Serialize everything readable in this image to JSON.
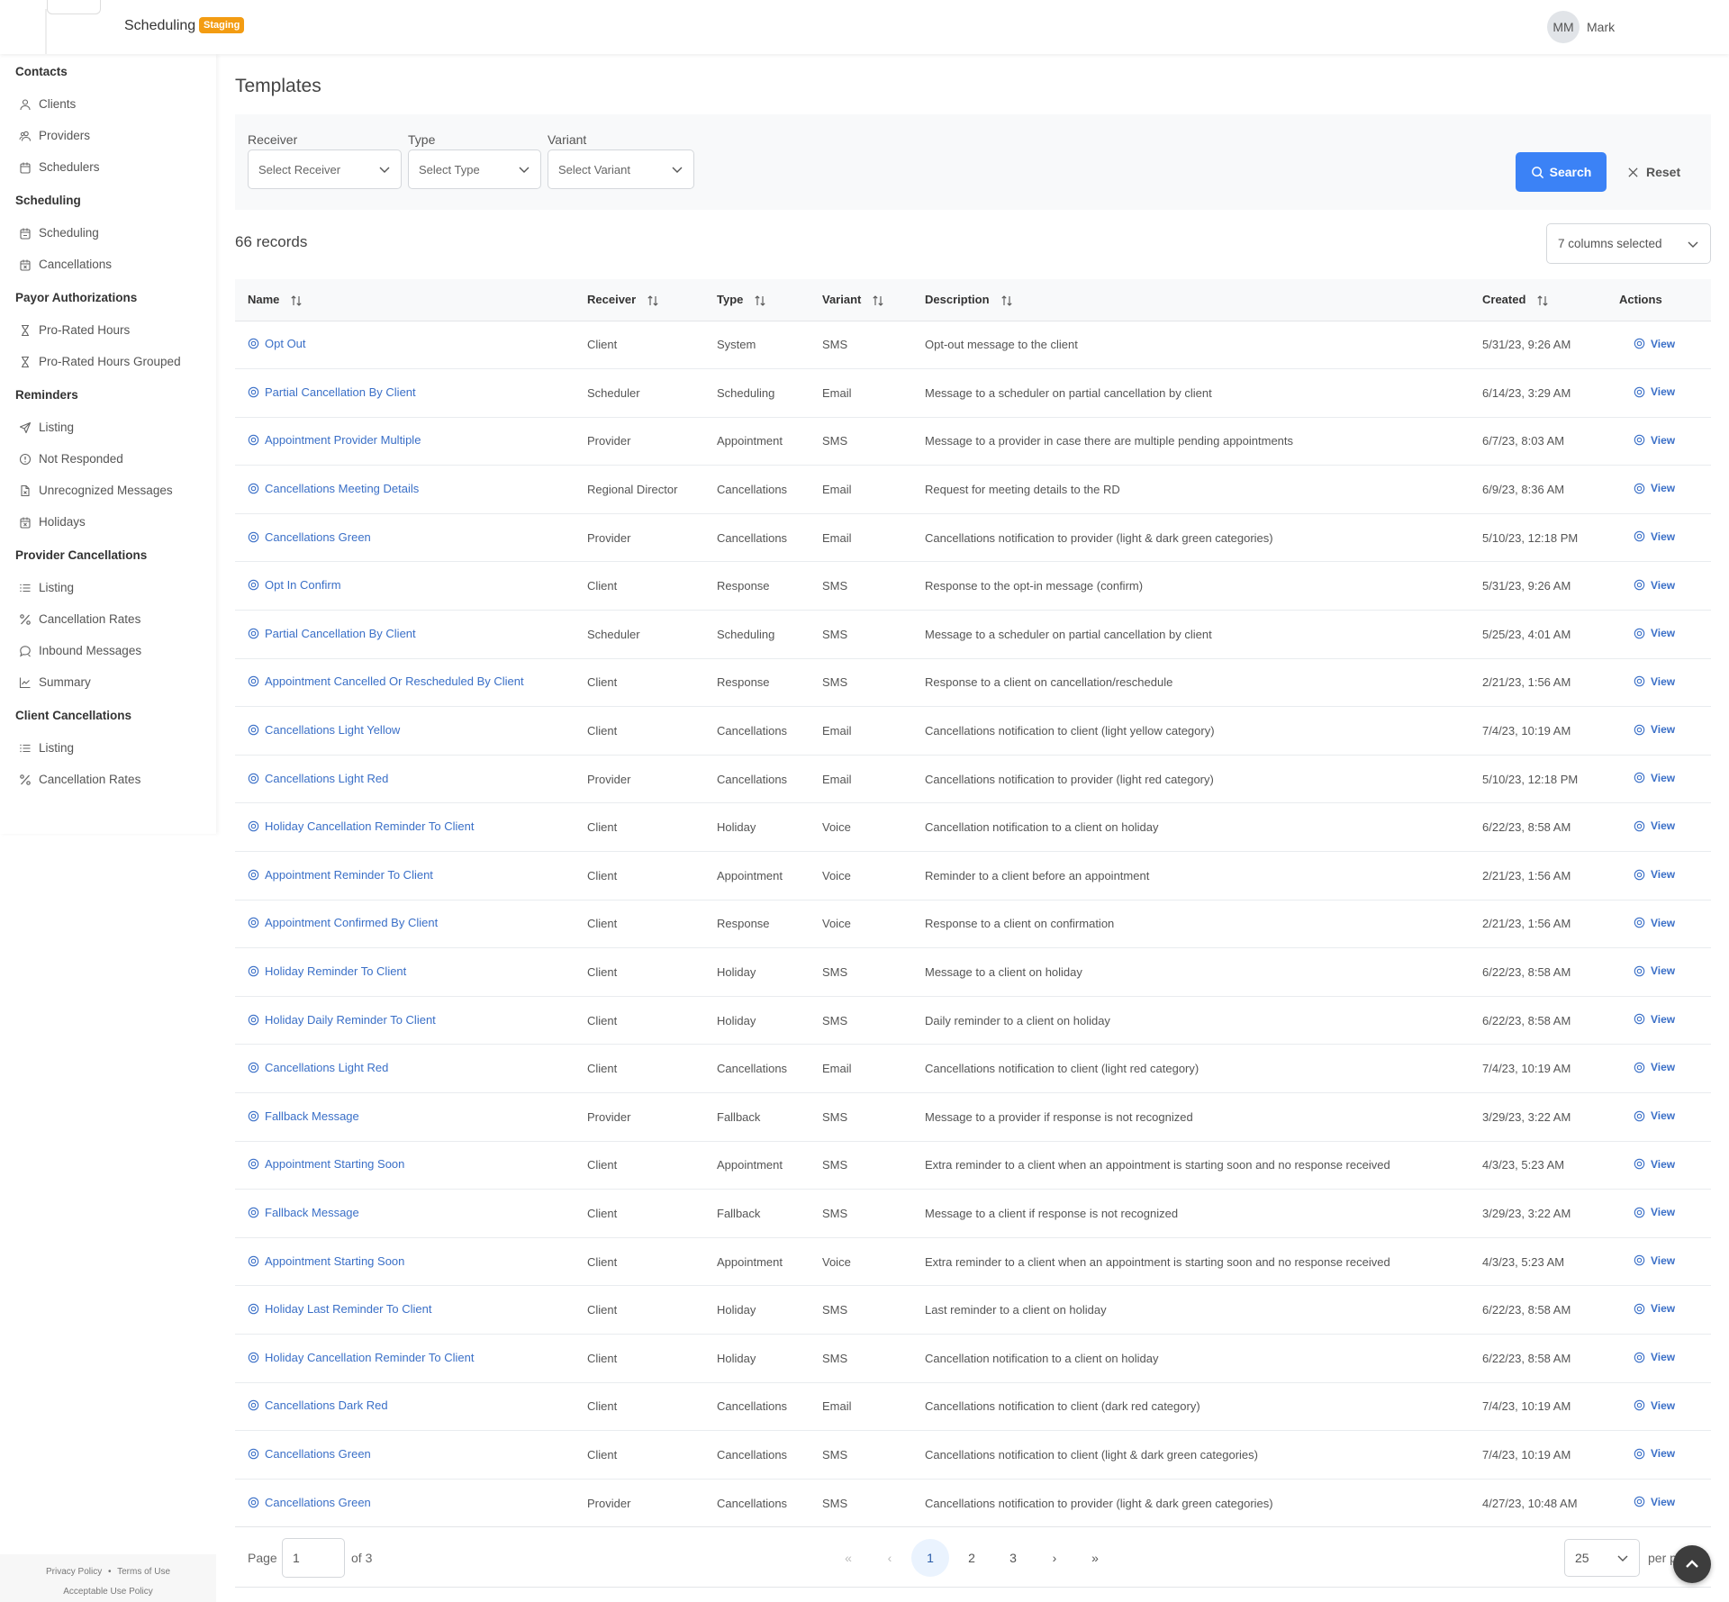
{
  "header": {
    "app_title": "Scheduling",
    "env_badge": "Staging",
    "user_initials": "MM",
    "user_name": "Mark"
  },
  "sidebar": {
    "sections": [
      {
        "title": "Contacts",
        "items": [
          {
            "label": "Clients",
            "icon": "user-icon"
          },
          {
            "label": "Providers",
            "icon": "users-icon"
          },
          {
            "label": "Schedulers",
            "icon": "calendar-icon"
          }
        ]
      },
      {
        "title": "Scheduling",
        "items": [
          {
            "label": "Scheduling",
            "icon": "calendar-minus-icon"
          },
          {
            "label": "Cancellations",
            "icon": "calendar-x-icon"
          }
        ]
      },
      {
        "title": "Payor Authorizations",
        "items": [
          {
            "label": "Pro-Rated Hours",
            "icon": "hourglass-icon"
          },
          {
            "label": "Pro-Rated Hours Grouped",
            "icon": "hourglass-icon"
          }
        ]
      },
      {
        "title": "Reminders",
        "items": [
          {
            "label": "Listing",
            "icon": "send-icon"
          },
          {
            "label": "Not Responded",
            "icon": "alert-circle-icon"
          },
          {
            "label": "Unrecognized Messages",
            "icon": "file-x-icon"
          },
          {
            "label": "Holidays",
            "icon": "calendar-x-icon"
          }
        ]
      },
      {
        "title": "Provider Cancellations",
        "items": [
          {
            "label": "Listing",
            "icon": "list-icon"
          },
          {
            "label": "Cancellation Rates",
            "icon": "percent-icon"
          },
          {
            "label": "Inbound Messages",
            "icon": "message-icon"
          },
          {
            "label": "Summary",
            "icon": "chart-line-icon"
          }
        ]
      },
      {
        "title": "Client Cancellations",
        "items": [
          {
            "label": "Listing",
            "icon": "list-icon"
          },
          {
            "label": "Cancellation Rates",
            "icon": "percent-icon"
          }
        ]
      }
    ],
    "footer": {
      "privacy": "Privacy Policy",
      "separator": "•",
      "terms": "Terms of Use",
      "aup": "Acceptable Use Policy"
    }
  },
  "main": {
    "title": "Templates",
    "filters": {
      "receiver_label": "Receiver",
      "receiver_placeholder": "Select Receiver",
      "type_label": "Type",
      "type_placeholder": "Select Type",
      "variant_label": "Variant",
      "variant_placeholder": "Select Variant",
      "search_label": "Search",
      "reset_label": "Reset"
    },
    "records_count": "66",
    "records_label": "records",
    "columns_selected": "7 columns selected",
    "table": {
      "columns": [
        "Name",
        "Receiver",
        "Type",
        "Variant",
        "Description",
        "Created",
        "Actions"
      ],
      "view_label": "View",
      "rows": [
        {
          "name": "Opt Out",
          "receiver": "Client",
          "type": "System",
          "variant": "SMS",
          "description": "Opt-out message to the client",
          "created": "5/31/23, 9:26 AM"
        },
        {
          "name": "Partial Cancellation By Client",
          "receiver": "Scheduler",
          "type": "Scheduling",
          "variant": "Email",
          "description": "Message to a scheduler on partial cancellation by client",
          "created": "6/14/23, 3:29 AM"
        },
        {
          "name": "Appointment Provider Multiple",
          "receiver": "Provider",
          "type": "Appointment",
          "variant": "SMS",
          "description": "Message to a provider in case there are multiple pending appointments",
          "created": "6/7/23, 8:03 AM"
        },
        {
          "name": "Cancellations Meeting Details",
          "receiver": "Regional Director",
          "type": "Cancellations",
          "variant": "Email",
          "description": "Request for meeting details to the RD",
          "created": "6/9/23, 8:36 AM"
        },
        {
          "name": "Cancellations Green",
          "receiver": "Provider",
          "type": "Cancellations",
          "variant": "Email",
          "description": "Cancellations notification to provider (light & dark green categories)",
          "created": "5/10/23, 12:18 PM"
        },
        {
          "name": "Opt In Confirm",
          "receiver": "Client",
          "type": "Response",
          "variant": "SMS",
          "description": "Response to the opt-in message (confirm)",
          "created": "5/31/23, 9:26 AM"
        },
        {
          "name": "Partial Cancellation By Client",
          "receiver": "Scheduler",
          "type": "Scheduling",
          "variant": "SMS",
          "description": "Message to a scheduler on partial cancellation by client",
          "created": "5/25/23, 4:01 AM"
        },
        {
          "name": "Appointment Cancelled Or Rescheduled By Client",
          "receiver": "Client",
          "type": "Response",
          "variant": "SMS",
          "description": "Response to a client on cancellation/reschedule",
          "created": "2/21/23, 1:56 AM"
        },
        {
          "name": "Cancellations Light Yellow",
          "receiver": "Client",
          "type": "Cancellations",
          "variant": "Email",
          "description": "Cancellations notification to client (light yellow category)",
          "created": "7/4/23, 10:19 AM"
        },
        {
          "name": "Cancellations Light Red",
          "receiver": "Provider",
          "type": "Cancellations",
          "variant": "Email",
          "description": "Cancellations notification to provider (light red category)",
          "created": "5/10/23, 12:18 PM"
        },
        {
          "name": "Holiday Cancellation Reminder To Client",
          "receiver": "Client",
          "type": "Holiday",
          "variant": "Voice",
          "description": "Cancellation notification to a client on holiday",
          "created": "6/22/23, 8:58 AM"
        },
        {
          "name": "Appointment Reminder To Client",
          "receiver": "Client",
          "type": "Appointment",
          "variant": "Voice",
          "description": "Reminder to a client before an appointment",
          "created": "2/21/23, 1:56 AM"
        },
        {
          "name": "Appointment Confirmed By Client",
          "receiver": "Client",
          "type": "Response",
          "variant": "Voice",
          "description": "Response to a client on confirmation",
          "created": "2/21/23, 1:56 AM"
        },
        {
          "name": "Holiday Reminder To Client",
          "receiver": "Client",
          "type": "Holiday",
          "variant": "SMS",
          "description": "Message to a client on holiday",
          "created": "6/22/23, 8:58 AM"
        },
        {
          "name": "Holiday Daily Reminder To Client",
          "receiver": "Client",
          "type": "Holiday",
          "variant": "SMS",
          "description": "Daily reminder to a client on holiday",
          "created": "6/22/23, 8:58 AM"
        },
        {
          "name": "Cancellations Light Red",
          "receiver": "Client",
          "type": "Cancellations",
          "variant": "Email",
          "description": "Cancellations notification to client (light red category)",
          "created": "7/4/23, 10:19 AM"
        },
        {
          "name": "Fallback Message",
          "receiver": "Provider",
          "type": "Fallback",
          "variant": "SMS",
          "description": "Message to a provider if response is not recognized",
          "created": "3/29/23, 3:22 AM"
        },
        {
          "name": "Appointment Starting Soon",
          "receiver": "Client",
          "type": "Appointment",
          "variant": "SMS",
          "description": "Extra reminder to a client when an appointment is starting soon and no response received",
          "created": "4/3/23, 5:23 AM"
        },
        {
          "name": "Fallback Message",
          "receiver": "Client",
          "type": "Fallback",
          "variant": "SMS",
          "description": "Message to a client if response is not recognized",
          "created": "3/29/23, 3:22 AM"
        },
        {
          "name": "Appointment Starting Soon",
          "receiver": "Client",
          "type": "Appointment",
          "variant": "Voice",
          "description": "Extra reminder to a client when an appointment is starting soon and no response received",
          "created": "4/3/23, 5:23 AM"
        },
        {
          "name": "Holiday Last Reminder To Client",
          "receiver": "Client",
          "type": "Holiday",
          "variant": "SMS",
          "description": "Last reminder to a client on holiday",
          "created": "6/22/23, 8:58 AM"
        },
        {
          "name": "Holiday Cancellation Reminder To Client",
          "receiver": "Client",
          "type": "Holiday",
          "variant": "SMS",
          "description": "Cancellation notification to a client on holiday",
          "created": "6/22/23, 8:58 AM"
        },
        {
          "name": "Cancellations Dark Red",
          "receiver": "Client",
          "type": "Cancellations",
          "variant": "Email",
          "description": "Cancellations notification to client (dark red category)",
          "created": "7/4/23, 10:19 AM"
        },
        {
          "name": "Cancellations Green",
          "receiver": "Client",
          "type": "Cancellations",
          "variant": "SMS",
          "description": "Cancellations notification to client (light & dark green categories)",
          "created": "7/4/23, 10:19 AM"
        },
        {
          "name": "Cancellations Green",
          "receiver": "Provider",
          "type": "Cancellations",
          "variant": "SMS",
          "description": "Cancellations notification to provider (light & dark green categories)",
          "created": "4/27/23, 10:48 AM"
        }
      ]
    },
    "pagination": {
      "page_label": "Page",
      "current_page": "1",
      "of_label": "of",
      "total_pages": "3",
      "first": "«",
      "prev": "‹",
      "pages": [
        "1",
        "2",
        "3"
      ],
      "next": "›",
      "last": "»",
      "per_page": "25",
      "per_page_label": "per page"
    }
  },
  "colors": {
    "accent": "#3b82f6",
    "link": "#3a6fc7",
    "badge": "#f39c12"
  }
}
